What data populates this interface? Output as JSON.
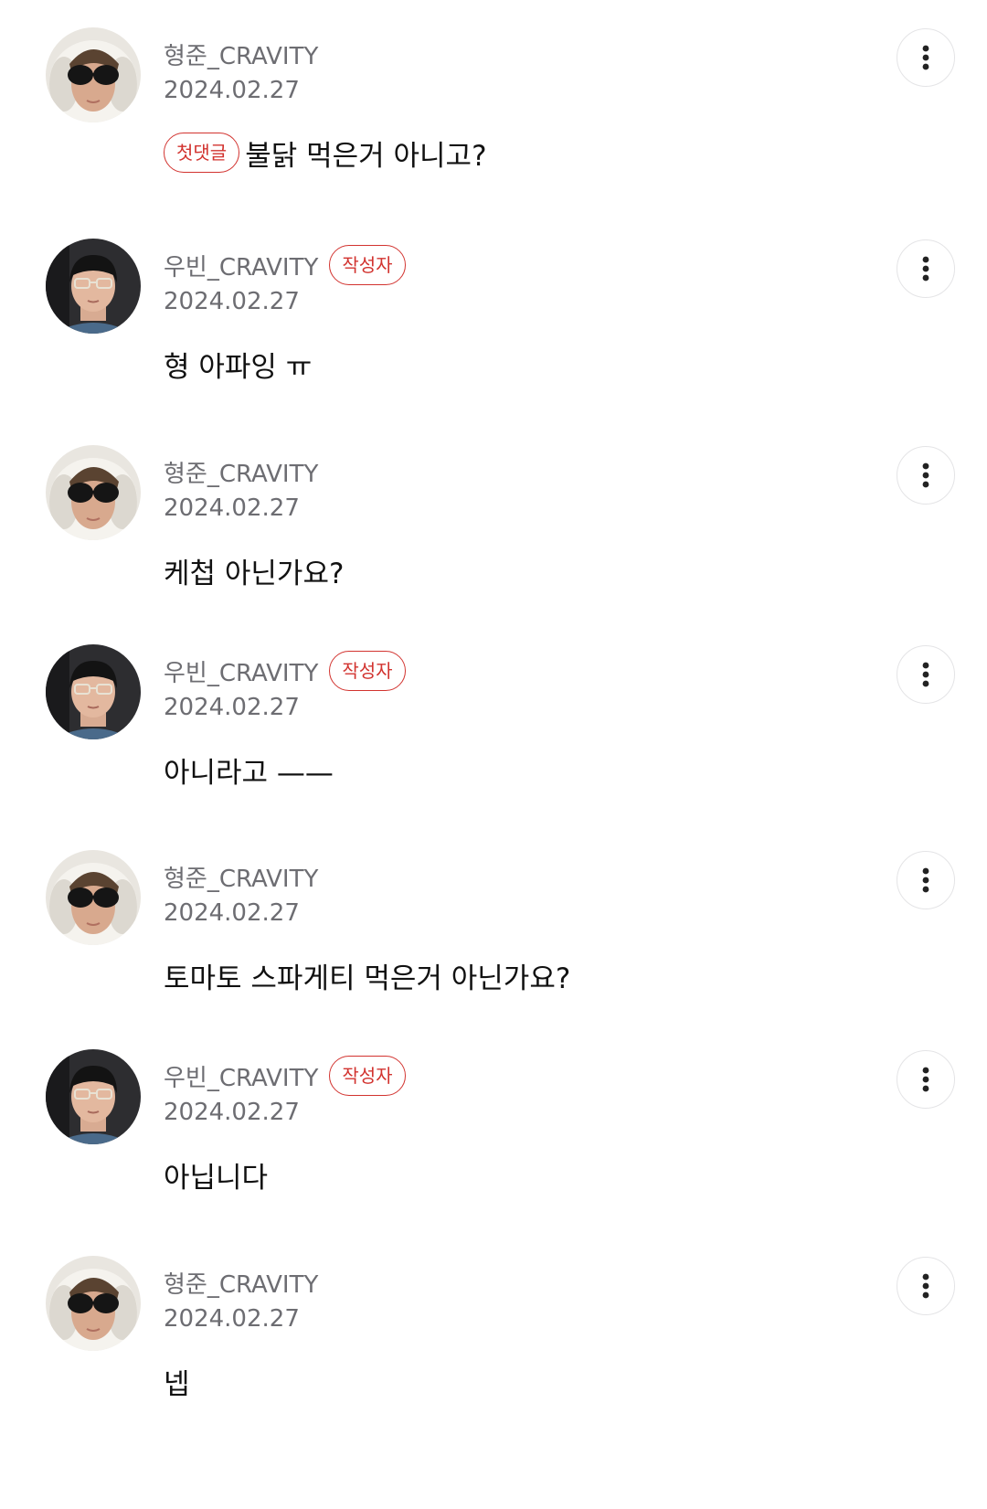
{
  "comments": [
    {
      "author": "형준_CRAVITY",
      "author_badge": "",
      "date": "2024.02.27",
      "text_badge": "첫댓글",
      "text": "불닭 먹은거 아니고?",
      "avatar": "avatar-hyeongjun"
    },
    {
      "author": "우빈_CRAVITY",
      "author_badge": "작성자",
      "date": "2024.02.27",
      "text_badge": "",
      "text": "형 아파잉 ㅠ",
      "avatar": "avatar-woobin"
    },
    {
      "author": "형준_CRAVITY",
      "author_badge": "",
      "date": "2024.02.27",
      "text_badge": "",
      "text": "케첩 아닌가요?",
      "avatar": "avatar-hyeongjun"
    },
    {
      "author": "우빈_CRAVITY",
      "author_badge": "작성자",
      "date": "2024.02.27",
      "text_badge": "",
      "text": "아니라고 ——",
      "avatar": "avatar-woobin"
    },
    {
      "author": "형준_CRAVITY",
      "author_badge": "",
      "date": "2024.02.27",
      "text_badge": "",
      "text": "토마토 스파게티 먹은거 아닌가요?",
      "avatar": "avatar-hyeongjun"
    },
    {
      "author": "우빈_CRAVITY",
      "author_badge": "작성자",
      "date": "2024.02.27",
      "text_badge": "",
      "text": "아닙니다",
      "avatar": "avatar-woobin"
    },
    {
      "author": "형준_CRAVITY",
      "author_badge": "",
      "date": "2024.02.27",
      "text_badge": "",
      "text": "넵",
      "avatar": "avatar-hyeongjun"
    }
  ],
  "icons": {
    "more": "more-vertical-icon"
  },
  "colors": {
    "badge": "#d2332f",
    "meta_text": "#6d6d72",
    "body_text": "#111111"
  }
}
